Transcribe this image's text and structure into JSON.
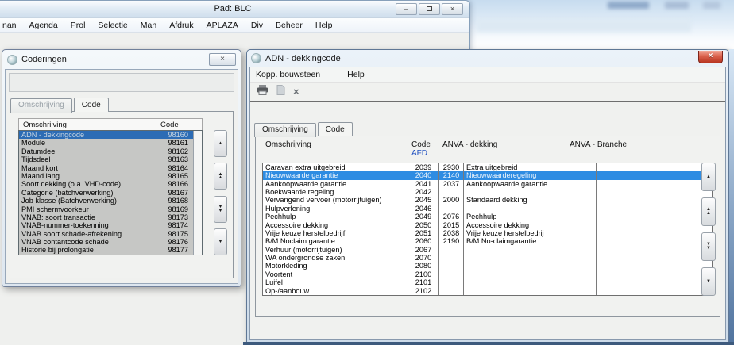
{
  "main_window": {
    "title": "Pad: BLC",
    "menu": [
      "nan",
      "Agenda",
      "Prol",
      "Selectie",
      "Man",
      "Afdruk",
      "APLAZA",
      "Div",
      "Beheer",
      "Help"
    ]
  },
  "coderingen_window": {
    "title": "Coderingen",
    "tabs": {
      "omschrijving": "Omschrijving",
      "code": "Code"
    },
    "list_headers": {
      "omschrijving": "Omschrijving",
      "code": "Code"
    },
    "selected_index": 0,
    "rows": [
      [
        "ADN - dekkingcode",
        "98160"
      ],
      [
        "Module",
        "98161"
      ],
      [
        "Datumdeel",
        "98162"
      ],
      [
        "Tijdsdeel",
        "98163"
      ],
      [
        "Maand kort",
        "98164"
      ],
      [
        "Maand lang",
        "98165"
      ],
      [
        "Soort dekking (o.a. VHD-code)",
        "98166"
      ],
      [
        "Categorie (batchverwerking)",
        "98167"
      ],
      [
        "Job klasse (Batchverwerking)",
        "98168"
      ],
      [
        "PMI schermvoorkeur",
        "98169"
      ],
      [
        "VNAB: soort transactie",
        "98173"
      ],
      [
        "VNAB-nummer-toekenning",
        "98174"
      ],
      [
        "VNAB soort schade-afrekening",
        "98175"
      ],
      [
        "VNAB contantcode schade",
        "98176"
      ],
      [
        "Historie bij prolongatie",
        "98177"
      ]
    ]
  },
  "adn_window": {
    "title": "ADN - dekkingcode",
    "menu": [
      "Kopp. bouwsteen",
      "Help"
    ],
    "toolbar_icons": [
      "print-icon",
      "new-document-icon",
      "delete-icon"
    ],
    "tabs": {
      "omschrijving": "Omschrijving",
      "code": "Code"
    },
    "table": {
      "headers": {
        "omschrijving": "Omschrijving",
        "code": "Code",
        "code_sub": "AFD",
        "anva_dekking": "ANVA - dekking",
        "anva_branche": "ANVA - Branche"
      },
      "selected_index": 1,
      "rows": [
        [
          "Caravan extra uitgebreid",
          "2039",
          "2930",
          "Extra uitgebreid",
          "",
          ""
        ],
        [
          "Nieuwwaarde garantie",
          "2040",
          "2140",
          "Nieuwwaarderegeling",
          "",
          ""
        ],
        [
          "Aankoopwaarde garantie",
          "2041",
          "2037",
          "Aankoopwaarde garantie",
          "",
          ""
        ],
        [
          "Boekwaarde regeling",
          "2042",
          "",
          "",
          "",
          ""
        ],
        [
          "Vervangend vervoer (motorrijtuigen)",
          "2045",
          "2000",
          "Standaard dekking",
          "",
          ""
        ],
        [
          "Hulpverlening",
          "2046",
          "",
          "",
          "",
          ""
        ],
        [
          "Pechhulp",
          "2049",
          "2076",
          "Pechhulp",
          "",
          ""
        ],
        [
          "Accessoire dekking",
          "2050",
          "2015",
          "Accessoire dekking",
          "",
          ""
        ],
        [
          "Vrije keuze herstelbedrijf",
          "2051",
          "2038",
          "Vrije keuze herstelbedrij",
          "",
          ""
        ],
        [
          "B/M Noclaim garantie",
          "2060",
          "2190",
          "B/M No-claimgarantie",
          "",
          ""
        ],
        [
          "Verhuur (motorrijtuigen)",
          "2067",
          "",
          "",
          "",
          ""
        ],
        [
          "WA ondergrondse zaken",
          "2070",
          "",
          "",
          "",
          ""
        ],
        [
          "Motorkleding",
          "2080",
          "",
          "",
          "",
          ""
        ],
        [
          "Voortent",
          "2100",
          "",
          "",
          "",
          ""
        ],
        [
          "Luifel",
          "2101",
          "",
          "",
          "",
          ""
        ],
        [
          "Op-/aanbouw",
          "2102",
          "",
          "",
          "",
          ""
        ]
      ]
    }
  },
  "icons": {
    "minimize_glyph": "–",
    "close_glyph": "×",
    "delete_glyph": "×",
    "up_glyph": "▲",
    "down_glyph": "▼"
  },
  "colors": {
    "selection_blue_active": "#2e8ce2",
    "selection_blue_inactive": "#2c6cb5",
    "afd_link_blue": "#2050c0",
    "close_button_red": "#c0392b"
  }
}
